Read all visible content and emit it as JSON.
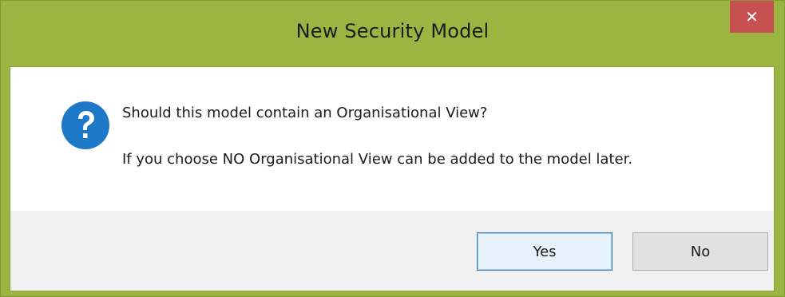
{
  "dialog": {
    "title": "New Security Model",
    "close_label": "✕",
    "message": "Should this model contain an Organisational View?",
    "detail": "If you choose NO Organisational View can be added to the model later.",
    "icon": "question-icon",
    "buttons": {
      "yes_label": "Yes",
      "no_label": "No"
    }
  },
  "colors": {
    "frame": "#9cb542",
    "close": "#c75050",
    "icon": "#1e78c8",
    "footer": "#f0f0f0"
  }
}
